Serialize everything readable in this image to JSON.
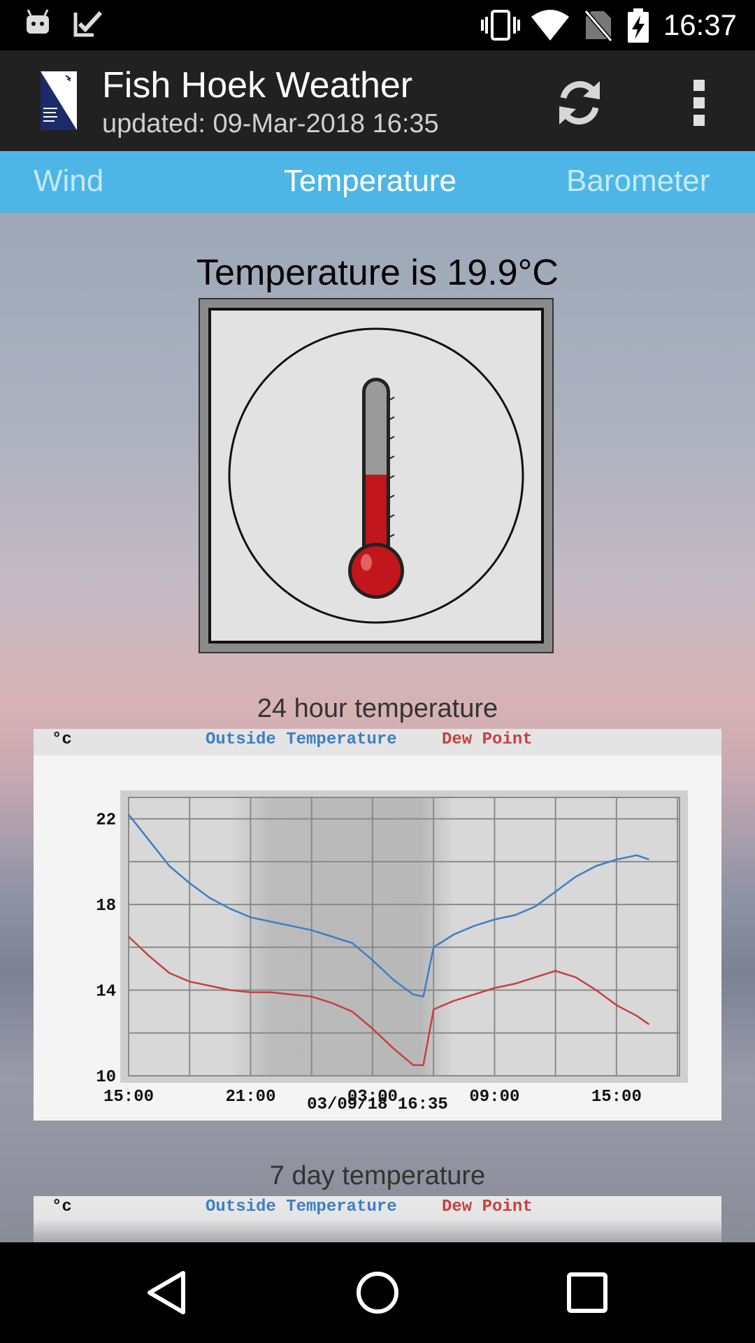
{
  "status_bar": {
    "time": "16:37"
  },
  "app_bar": {
    "title": "Fish Hoek Weather",
    "subtitle": "updated: 09-Mar-2018 16:35"
  },
  "tabs": [
    {
      "label": "Wind",
      "active": false
    },
    {
      "label": "Temperature",
      "active": true
    },
    {
      "label": "Barometer",
      "active": false
    }
  ],
  "temperature": {
    "heading": "Temperature is 19.9°C",
    "value_c": 19.9
  },
  "chart_24h": {
    "caption": "24 hour temperature",
    "unit_label": "°c",
    "legend": [
      {
        "label": "Outside Temperature",
        "color": "#3d7fc6"
      },
      {
        "label": "Dew Point",
        "color": "#c84040"
      }
    ],
    "footer": "03/09/18 16:35"
  },
  "chart_7d": {
    "caption": "7 day temperature",
    "unit_label": "°c",
    "legend": [
      {
        "label": "Outside Temperature",
        "color": "#3d7fc6"
      },
      {
        "label": "Dew Point",
        "color": "#c84040"
      }
    ]
  },
  "chart_data": [
    {
      "type": "line",
      "ylim": [
        10,
        24
      ],
      "y_ticks": [
        "22",
        "18",
        "14",
        "10"
      ],
      "x_ticks": [
        "15:00",
        "21:00",
        "03:00",
        "09:00",
        "15:00"
      ],
      "x_hours": [
        15,
        16,
        17,
        18,
        19,
        20,
        21,
        22,
        23,
        24,
        25,
        26,
        27,
        28,
        29,
        29.5,
        30,
        31,
        32,
        33,
        34,
        35,
        36,
        37,
        38,
        39,
        40,
        40.6
      ],
      "series": [
        {
          "name": "Outside Temperature",
          "color": "#3d7fc6",
          "values": [
            22.2,
            21.0,
            19.8,
            19.0,
            18.3,
            17.8,
            17.4,
            17.2,
            17.0,
            16.8,
            16.5,
            16.2,
            15.4,
            14.5,
            13.8,
            13.7,
            16.0,
            16.6,
            17.0,
            17.3,
            17.5,
            17.9,
            18.6,
            19.3,
            19.8,
            20.1,
            20.3,
            20.1
          ]
        },
        {
          "name": "Dew Point",
          "color": "#c84040",
          "values": [
            16.5,
            15.6,
            14.8,
            14.4,
            14.2,
            14.0,
            13.9,
            13.9,
            13.8,
            13.7,
            13.4,
            13.0,
            12.2,
            11.3,
            10.5,
            10.5,
            13.1,
            13.5,
            13.8,
            14.1,
            14.3,
            14.6,
            14.9,
            14.6,
            14.0,
            13.3,
            12.8,
            12.4
          ]
        }
      ]
    }
  ],
  "colors": {
    "tab_bar": "#4db6e6",
    "app_bar": "#212121",
    "mercury": "#c0161c"
  },
  "icons": [
    "android-icon",
    "checkmark-icon",
    "vibrate-icon",
    "wifi-icon",
    "no-sim-icon",
    "battery-charging-icon",
    "refresh-icon",
    "more-vert-icon",
    "back-icon",
    "home-icon",
    "recents-icon",
    "thermometer-icon"
  ]
}
